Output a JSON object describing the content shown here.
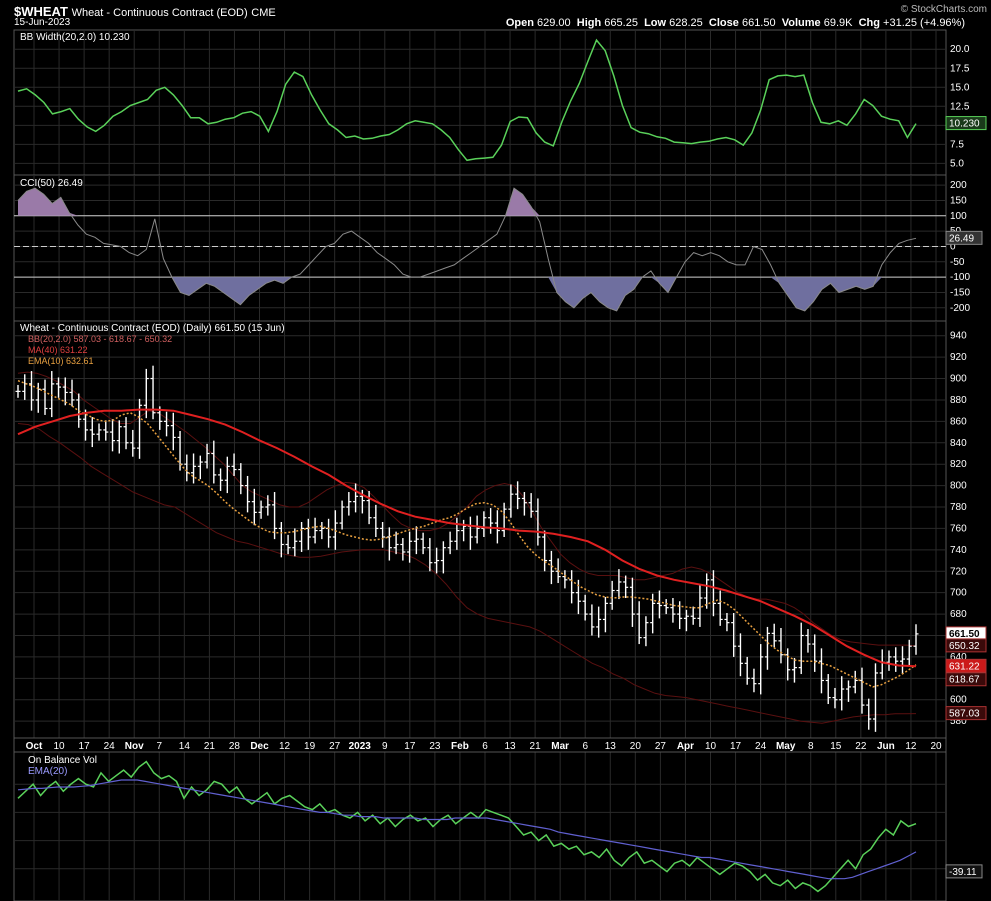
{
  "header": {
    "symbol": "$WHEAT",
    "name": "Wheat - Continuous Contract (EOD)",
    "exchange": "CME",
    "date": "15-Jun-2023",
    "brand": "© StockCharts.com",
    "open_label": "Open",
    "open": "629.00",
    "high_label": "High",
    "high": "665.25",
    "low_label": "Low",
    "low": "628.25",
    "close_label": "Close",
    "close": "661.50",
    "volume_label": "Volume",
    "volume": "69.9K",
    "chg_label": "Chg",
    "chg": "+31.25 (+4.96%)"
  },
  "colors": {
    "background": "#000000",
    "grid": "#2a2a2a",
    "bbwidth": "#5ad15a",
    "cci_line": "#8a8a8a",
    "cci_fill_pos": "#9a7aa8",
    "cci_fill_neg": "#6f6f9f",
    "price_bars": "#ffffff",
    "ma": "#e02020",
    "ema": "#e8a040",
    "bb": "#5a1010",
    "obv": "#5ad15a",
    "obv_ema": "#6060d0"
  },
  "x_axis": {
    "labels": [
      {
        "text": "Oct",
        "bold": true
      },
      {
        "text": "10"
      },
      {
        "text": "17"
      },
      {
        "text": "24"
      },
      {
        "text": "Nov",
        "bold": true
      },
      {
        "text": "7"
      },
      {
        "text": "14"
      },
      {
        "text": "21"
      },
      {
        "text": "28"
      },
      {
        "text": "Dec",
        "bold": true
      },
      {
        "text": "12"
      },
      {
        "text": "19"
      },
      {
        "text": "27"
      },
      {
        "text": "2023",
        "bold": true
      },
      {
        "text": "9"
      },
      {
        "text": "17"
      },
      {
        "text": "23"
      },
      {
        "text": "Feb",
        "bold": true
      },
      {
        "text": "6"
      },
      {
        "text": "13"
      },
      {
        "text": "21"
      },
      {
        "text": "Mar",
        "bold": true
      },
      {
        "text": "6"
      },
      {
        "text": "13"
      },
      {
        "text": "20"
      },
      {
        "text": "27"
      },
      {
        "text": "Apr",
        "bold": true
      },
      {
        "text": "10"
      },
      {
        "text": "17"
      },
      {
        "text": "24"
      },
      {
        "text": "May",
        "bold": true
      },
      {
        "text": "8"
      },
      {
        "text": "15"
      },
      {
        "text": "22"
      },
      {
        "text": "Jun",
        "bold": true
      },
      {
        "text": "12"
      },
      {
        "text": "20"
      }
    ]
  },
  "chart_data": [
    {
      "type": "line",
      "panel": "bbwidth",
      "legend": "BB Width(20,2.0) 10.230",
      "last_value": "10.230",
      "ylim": [
        4,
        22
      ],
      "yticks": [
        "20.0",
        "17.5",
        "15.0",
        "12.5",
        "10.0",
        "7.5",
        "5.0"
      ],
      "values": [
        14.5,
        14.8,
        14,
        13,
        11.5,
        11.8,
        12.2,
        10.8,
        9.8,
        9.2,
        10,
        11.2,
        11.8,
        12.6,
        13,
        13.4,
        14.6,
        15,
        14,
        12.6,
        11,
        11,
        10.2,
        10.4,
        10.8,
        11,
        11.6,
        11.8,
        11.2,
        9.2,
        11.8,
        15.4,
        17,
        16.4,
        14,
        12,
        10.2,
        9.4,
        8.4,
        8.6,
        8.2,
        8.3,
        8.6,
        8.8,
        9.4,
        10.2,
        10.6,
        10.4,
        10.2,
        9.4,
        8.4,
        6.8,
        5.4,
        5.6,
        5.7,
        5.8,
        7.4,
        10.5,
        11.1,
        11,
        9,
        7.8,
        7.3,
        10.5,
        13.2,
        15.5,
        18.4,
        21.2,
        19.8,
        16.5,
        12.6,
        9.7,
        9.1,
        8.9,
        8.5,
        8.3,
        7.8,
        7.7,
        7.6,
        7.8,
        7.9,
        8.2,
        8.4,
        8.1,
        7.4,
        9,
        12,
        16,
        16.5,
        16.6,
        16.4,
        16.6,
        13,
        10.4,
        10.2,
        10.6,
        10,
        11.5,
        13.4,
        12.6,
        11.2,
        10.8,
        10.6,
        8.4,
        10.23
      ]
    },
    {
      "type": "area",
      "panel": "cci",
      "legend": "CCI(50) 26.49",
      "last_value": "26.49",
      "ylim": [
        -230,
        220
      ],
      "yticks": [
        "200",
        "150",
        "100",
        "50",
        "0",
        "-50",
        "-100",
        "-150",
        "-200"
      ],
      "values": [
        150,
        180,
        190,
        170,
        140,
        160,
        110,
        70,
        40,
        30,
        10,
        5,
        0,
        -20,
        -30,
        -10,
        90,
        -40,
        -100,
        -150,
        -160,
        -140,
        -120,
        -130,
        -150,
        -170,
        -190,
        -160,
        -140,
        -120,
        -110,
        -120,
        -100,
        -90,
        -60,
        -30,
        0,
        10,
        40,
        50,
        30,
        10,
        -20,
        -40,
        -60,
        -90,
        -100,
        -100,
        -90,
        -80,
        -70,
        -60,
        -40,
        -20,
        0,
        20,
        40,
        100,
        190,
        170,
        130,
        80,
        -40,
        -150,
        -180,
        -200,
        -170,
        -150,
        -180,
        -200,
        -210,
        -160,
        -140,
        -100,
        -80,
        -120,
        -150,
        -100,
        -50,
        -20,
        -30,
        -20,
        -30,
        -50,
        -60,
        -60,
        0,
        -10,
        -60,
        -120,
        -160,
        -200,
        -210,
        -180,
        -140,
        -120,
        -150,
        -140,
        -130,
        -140,
        -130,
        -60,
        -20,
        10,
        20,
        26.49
      ]
    },
    {
      "type": "ohlc",
      "panel": "price",
      "legend": "Wheat - Continuous Contract (EOD) (Daily) 661.50 (15 Jun)",
      "bb_legend": "BB(20,2.0) 587.03 - 618.67 - 650.32",
      "ma_legend": "MA(40) 631.22",
      "ema_legend": "EMA(10) 632.61",
      "ylim": [
        568,
        950
      ],
      "yticks": [
        "940",
        "920",
        "900",
        "880",
        "860",
        "840",
        "820",
        "800",
        "780",
        "760",
        "740",
        "720",
        "700",
        "680",
        "660",
        "640",
        "620",
        "600",
        "580"
      ],
      "last_labels": [
        {
          "value": 661.5,
          "text": "661.50",
          "kind": "close"
        },
        {
          "value": 650.32,
          "text": "650.32",
          "kind": "bb"
        },
        {
          "value": 631.22,
          "text": "631.22",
          "kind": "ma"
        },
        {
          "value": 618.67,
          "text": "618.67",
          "kind": "bb"
        },
        {
          "value": 587.03,
          "text": "587.03",
          "kind": "bb"
        }
      ],
      "close": [
        888,
        895,
        880,
        890,
        872,
        895,
        892,
        887,
        880,
        862,
        852,
        848,
        852,
        850,
        842,
        855,
        840,
        835,
        875,
        900,
        868,
        860,
        856,
        845,
        820,
        812,
        818,
        822,
        830,
        810,
        805,
        818,
        815,
        800,
        785,
        775,
        780,
        782,
        760,
        745,
        742,
        748,
        760,
        752,
        758,
        760,
        752,
        765,
        780,
        785,
        790,
        786,
        770,
        760,
        752,
        742,
        745,
        738,
        748,
        750,
        742,
        728,
        730,
        742,
        748,
        758,
        762,
        752,
        760,
        770,
        765,
        758,
        778,
        792,
        788,
        784,
        776,
        752,
        730,
        720,
        715,
        712,
        700,
        692,
        680,
        668,
        675,
        690,
        702,
        710,
        705,
        680,
        658,
        672,
        690,
        688,
        686,
        680,
        676,
        678,
        676,
        695,
        712,
        690,
        675,
        672,
        650,
        634,
        620,
        615,
        640,
        662,
        655,
        642,
        628,
        630,
        660,
        652,
        636,
        618,
        602,
        600,
        610,
        612,
        618,
        595,
        582,
        625,
        635,
        640,
        636,
        638,
        650,
        661.5
      ],
      "ma": [
        848,
        855,
        860,
        865,
        868,
        870,
        870,
        871,
        871,
        870,
        866,
        862,
        857,
        850,
        842,
        835,
        827,
        818,
        810,
        800,
        791,
        783,
        776,
        771,
        768,
        765,
        763,
        761,
        760,
        758,
        757,
        755,
        752,
        748,
        740,
        730,
        722,
        716,
        712,
        709,
        706,
        702,
        697,
        692,
        685,
        678,
        670,
        660,
        650,
        642,
        635,
        632,
        631.22
      ],
      "ema": [
        898,
        895,
        892,
        888,
        884,
        880,
        876,
        870,
        866,
        862,
        860,
        861,
        866,
        868,
        864,
        858,
        848,
        838,
        828,
        818,
        810,
        805,
        800,
        793,
        785,
        778,
        772,
        766,
        761,
        757,
        756,
        756,
        757,
        759,
        761,
        762,
        760,
        757,
        754,
        752,
        750,
        749,
        750,
        752,
        755,
        758,
        760,
        762,
        765,
        768,
        770,
        774,
        779,
        783,
        784,
        782,
        776,
        766,
        754,
        743,
        735,
        729,
        724,
        718,
        712,
        706,
        702,
        698,
        696,
        695,
        696,
        696,
        695,
        694,
        692,
        690,
        688,
        687,
        686,
        686,
        690,
        693,
        690,
        684,
        676,
        668,
        660,
        652,
        646,
        641,
        637,
        636,
        636,
        634,
        632,
        628,
        624,
        620,
        616,
        612,
        614,
        618,
        622,
        627,
        632.61
      ],
      "bb_upper": [
        905,
        906,
        905,
        902,
        898,
        893,
        888,
        880,
        874,
        868,
        862,
        858,
        858,
        864,
        870,
        868,
        862,
        856,
        850,
        843,
        836,
        828,
        820,
        810,
        800,
        794,
        790,
        786,
        782,
        780,
        780,
        784,
        790,
        796,
        800,
        803,
        802,
        798,
        790,
        781,
        772,
        764,
        760,
        758,
        758,
        760,
        765,
        772,
        780,
        790,
        796,
        800,
        802,
        800,
        790,
        775,
        760,
        748,
        736,
        728,
        722,
        718,
        716,
        716,
        716,
        714,
        712,
        712,
        714,
        716,
        718,
        722,
        724,
        722,
        718,
        712,
        706,
        700,
        696,
        694,
        694,
        692,
        690,
        686,
        680,
        672,
        666,
        660,
        656,
        654,
        653,
        652,
        651,
        651,
        651,
        651,
        650.32
      ],
      "bb_lower": [
        858,
        857,
        853,
        846,
        840,
        833,
        826,
        818,
        812,
        806,
        800,
        794,
        790,
        786,
        782,
        780,
        774,
        768,
        762,
        756,
        752,
        748,
        746,
        743,
        740,
        737,
        735,
        733,
        733,
        734,
        736,
        738,
        739,
        740,
        740,
        740,
        738,
        736,
        732,
        726,
        718,
        708,
        696,
        686,
        680,
        676,
        674,
        672,
        670,
        668,
        664,
        658,
        652,
        646,
        640,
        634,
        630,
        624,
        620,
        614,
        610,
        606,
        604,
        603,
        602,
        600,
        598,
        596,
        594,
        592,
        590,
        588,
        586,
        584,
        582,
        580,
        579,
        578,
        580,
        582,
        584,
        585,
        586,
        586,
        587,
        587,
        587.03
      ]
    },
    {
      "type": "line",
      "panel": "obv",
      "legend": "On Balance Vol",
      "ema_legend": "EMA(20)",
      "last_value": "-39.11",
      "ylim": [
        0,
        100
      ],
      "values": [
        70,
        75,
        80,
        72,
        78,
        82,
        75,
        80,
        84,
        80,
        78,
        88,
        82,
        86,
        90,
        85,
        92,
        96,
        88,
        84,
        86,
        82,
        70,
        78,
        72,
        76,
        82,
        80,
        74,
        78,
        70,
        66,
        70,
        74,
        66,
        70,
        72,
        68,
        64,
        62,
        66,
        60,
        62,
        58,
        56,
        60,
        54,
        58,
        52,
        56,
        50,
        55,
        58,
        54,
        56,
        50,
        55,
        58,
        52,
        56,
        60,
        56,
        62,
        60,
        58,
        56,
        50,
        44,
        46,
        40,
        44,
        36,
        38,
        34,
        36,
        30,
        32,
        28,
        34,
        26,
        22,
        28,
        32,
        24,
        26,
        22,
        18,
        24,
        26,
        22,
        28,
        24,
        20,
        16,
        20,
        24,
        22,
        18,
        12,
        16,
        10,
        8,
        12,
        6,
        10,
        8,
        4,
        8,
        14,
        20,
        26,
        20,
        30,
        34,
        42,
        48,
        44,
        54,
        50,
        52
      ],
      "ema": [
        76,
        76.5,
        77,
        77,
        77.5,
        78,
        78,
        78,
        78.5,
        79,
        80,
        81,
        82,
        83,
        83,
        83,
        82,
        81,
        80,
        79,
        78,
        77,
        76,
        75,
        74,
        73,
        72,
        71,
        70,
        69,
        68,
        67,
        66,
        65,
        64,
        63,
        62,
        61,
        60,
        60,
        59,
        58,
        58,
        57,
        57,
        57,
        56,
        56,
        56,
        56,
        56,
        55,
        55,
        55,
        55,
        56,
        56,
        56,
        56,
        56,
        55,
        54,
        53,
        52,
        51,
        50,
        49,
        48,
        46,
        45,
        44,
        43,
        42,
        41,
        40,
        39,
        38,
        37,
        36,
        35,
        34,
        33,
        32,
        31,
        30,
        29,
        28,
        28,
        27,
        26,
        25,
        24,
        23,
        22,
        21,
        20,
        19,
        18,
        17,
        16,
        15,
        14,
        13,
        13,
        13,
        14,
        16,
        18,
        20,
        22,
        24,
        26,
        29,
        32
      ]
    }
  ]
}
